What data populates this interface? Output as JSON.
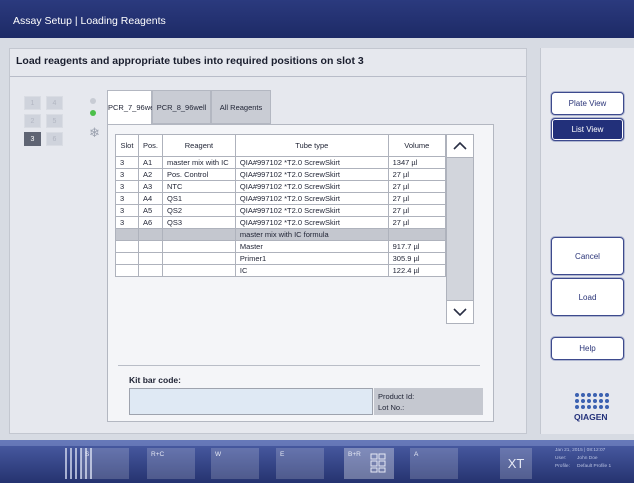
{
  "titlebar": {
    "title": "Assay Setup | Loading Reagents"
  },
  "heading": "Load reagents and appropriate tubes into required positions on slot 3",
  "slots": [
    "1",
    "4",
    "2",
    "5",
    "3",
    "6"
  ],
  "tabs": [
    "PCR_7_96well",
    "PCR_8_96well",
    "All Reagents"
  ],
  "table": {
    "headers": [
      "Slot",
      "Pos.",
      "Reagent",
      "Tube type",
      "Volume"
    ],
    "rows": [
      [
        "3",
        "A1",
        "master mix with IC",
        "QIA#997102 *T2.0 ScrewSkirt",
        "1347 µl"
      ],
      [
        "3",
        "A2",
        "Pos. Control",
        "QIA#997102 *T2.0 ScrewSkirt",
        "27 µl"
      ],
      [
        "3",
        "A3",
        "NTC",
        "QIA#997102 *T2.0 ScrewSkirt",
        "27 µl"
      ],
      [
        "3",
        "A4",
        "QS1",
        "QIA#997102 *T2.0 ScrewSkirt",
        "27 µl"
      ],
      [
        "3",
        "A5",
        "QS2",
        "QIA#997102 *T2.0 ScrewSkirt",
        "27 µl"
      ],
      [
        "3",
        "A6",
        "QS3",
        "QIA#997102 *T2.0 ScrewSkirt",
        "27 µl"
      ]
    ],
    "section_title": "master mix with IC formula",
    "formula_rows": [
      [
        "",
        "",
        "",
        "Master",
        "917.7 µl"
      ],
      [
        "",
        "",
        "",
        "Primer1",
        "305.9 µl"
      ],
      [
        "",
        "",
        "",
        "IC",
        "122.4 µl"
      ]
    ]
  },
  "kit": {
    "label": "Kit bar code:",
    "value": "",
    "product_id_label": "Product Id:",
    "lot_no_label": "Lot No.:"
  },
  "right_buttons": {
    "plate_view": "Plate View",
    "list_view": "List View",
    "cancel": "Cancel",
    "load": "Load",
    "help": "Help"
  },
  "logo_text": "QIAGEN",
  "bottombar": {
    "items": [
      "S",
      "R+C",
      "W",
      "E",
      "B+R",
      "A"
    ],
    "xt_label": "XT",
    "info": {
      "datetime": "Jan 21, 2015 | 08:12:07",
      "user_label": "User:",
      "user": "John Doe",
      "profile_label": "Profile:",
      "profile": "Default Profile 1"
    }
  },
  "colors": {
    "titlebar": "#1d2a66",
    "accent": "#22307a",
    "status_green": "#4cc04a"
  }
}
